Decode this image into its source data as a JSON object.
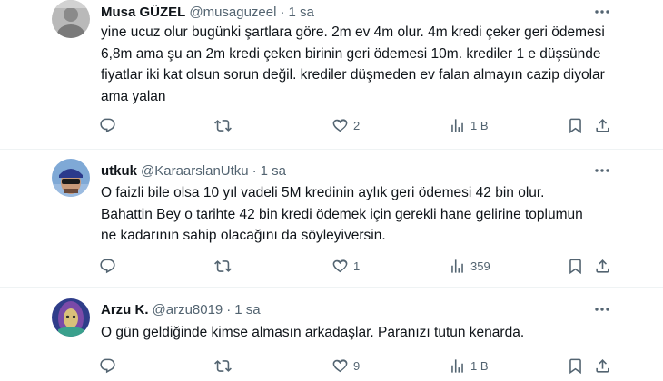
{
  "tweets": [
    {
      "name": "Musa GÜZEL",
      "handle": "@musaguzeel",
      "dot": "·",
      "time": "1 sa",
      "text": "yine ucuz olur bugünki şartlara göre. 2m ev 4m olur. 4m kredi çeker geri ödemesi 6,8m  ama şu an 2m kredi çeken birinin geri ödemesi 10m. krediler 1 e düşsünde fiyatlar iki kat olsun sorun değil. krediler düşmeden ev falan almayın cazip diyolar ama yalan",
      "replies": "",
      "reposts": "",
      "likes": "2",
      "views": "1 B"
    },
    {
      "name": "utkuk",
      "handle": "@KaraarslanUtku",
      "dot": "·",
      "time": "1 sa",
      "text": "O faizli bile olsa 10 yıl vadeli 5M kredinin aylık geri ödemesi 42 bin olur. Bahattin Bey o tarihte 42 bin kredi ödemek için gerekli hane gelirine toplumun ne kadarının sahip olacağını da söyleyiversin.",
      "replies": "",
      "reposts": "",
      "likes": "1",
      "views": "359"
    },
    {
      "name": "Arzu K.",
      "handle": "@arzu8019",
      "dot": "·",
      "time": "1 sa",
      "text": "O gün geldiğinde kimse almasın arkadaşlar. Paranızı tutun kenarda.",
      "replies": "",
      "reposts": "",
      "likes": "9",
      "views": "1 B"
    }
  ],
  "icons": {
    "reply": "reply-icon",
    "repost": "repost-icon",
    "like": "heart-icon",
    "views": "views-icon",
    "bookmark": "bookmark-icon",
    "share": "share-icon",
    "more": "more-icon"
  }
}
